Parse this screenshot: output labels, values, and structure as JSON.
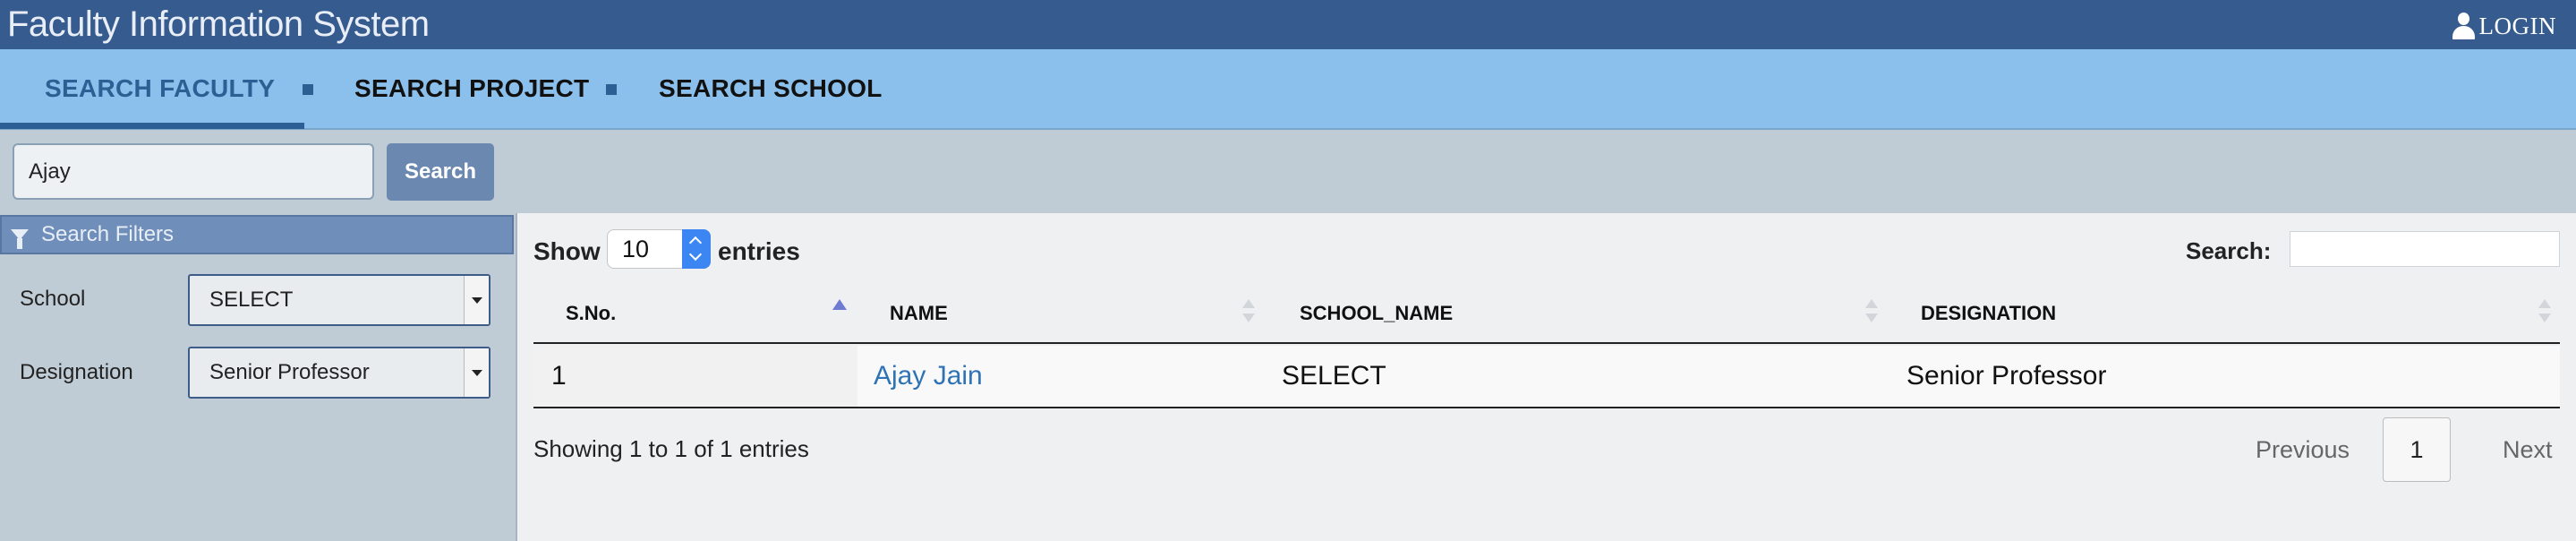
{
  "app": {
    "title": "Faculty Information System",
    "login_label": "LOGIN"
  },
  "nav": {
    "items": [
      {
        "label": "SEARCH FACULTY",
        "active": true
      },
      {
        "label": "SEARCH PROJECT",
        "active": false
      },
      {
        "label": "SEARCH SCHOOL",
        "active": false
      }
    ]
  },
  "search": {
    "value": "Ajay",
    "button_label": "Search"
  },
  "filters": {
    "header": "Search Filters",
    "school": {
      "label": "School",
      "value": "SELECT"
    },
    "designation": {
      "label": "Designation",
      "value": "Senior Professor"
    }
  },
  "table_controls": {
    "show_label": "Show",
    "entries_value": "10",
    "entries_label": "entries",
    "search_label": "Search:",
    "search_value": ""
  },
  "table": {
    "columns": [
      "S.No.",
      "NAME",
      "SCHOOL_NAME",
      "DESIGNATION"
    ],
    "sorted_column": "S.No.",
    "rows": [
      {
        "sno": "1",
        "name": "Ajay Jain",
        "school_name": "SELECT",
        "designation": "Senior Professor"
      }
    ]
  },
  "footer": {
    "info": "Showing 1 to 1 of 1 entries",
    "previous_label": "Previous",
    "current_page": "1",
    "next_label": "Next"
  },
  "colors": {
    "topbar": "#355b8f",
    "navbar": "#8bc0ec",
    "accent": "#2c5f93",
    "link": "#2f73b5",
    "search_button": "#6b88b0"
  }
}
